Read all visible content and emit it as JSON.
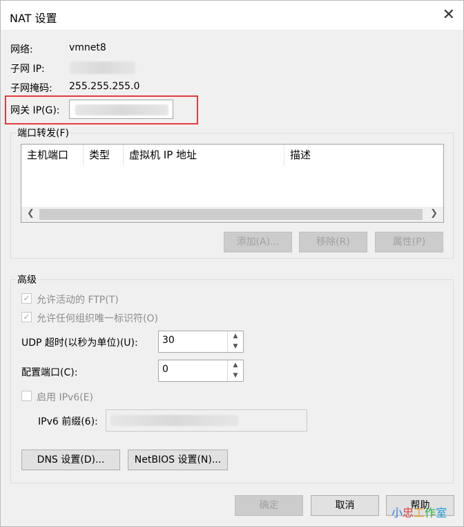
{
  "window": {
    "title": "NAT 设置",
    "close_icon": "close-icon"
  },
  "info": {
    "network_label": "网络:",
    "network_value": "vmnet8",
    "subnet_ip_label": "子网 IP:",
    "subnet_mask_label": "子网掩码:",
    "subnet_mask_value": "255.255.255.0",
    "gateway_label": "网关 IP(G):"
  },
  "port_forwarding": {
    "group_title": "端口转发(F)",
    "columns": [
      "主机端口",
      "类型",
      "虚拟机 IP 地址",
      "描述"
    ],
    "buttons": {
      "add": "添加(A)...",
      "remove": "移除(R)",
      "properties": "属性(P)"
    }
  },
  "advanced": {
    "group_title": "高级",
    "allow_ftp": "允许活动的 FTP(T)",
    "allow_uuid": "允许任何组织唯一标识符(O)",
    "udp_timeout_label": "UDP 超时(以秒为单位)(U):",
    "udp_timeout_value": "30",
    "config_port_label": "配置端口(C):",
    "config_port_value": "0",
    "enable_ipv6": "启用 IPv6(E)",
    "ipv6_prefix_label": "IPv6 前缀(6):",
    "dns_button": "DNS 设置(D)...",
    "netbios_button": "NetBIOS 设置(N)..."
  },
  "footer": {
    "ok": "确定",
    "cancel": "取消",
    "help": "帮助"
  },
  "watermark": {
    "chars": [
      "小",
      "忠",
      "工",
      "作",
      "室"
    ],
    "colors": [
      "#2a7de1",
      "#e03a3a",
      "#f0a020",
      "#2ab04a",
      "#1b9ad6"
    ]
  }
}
